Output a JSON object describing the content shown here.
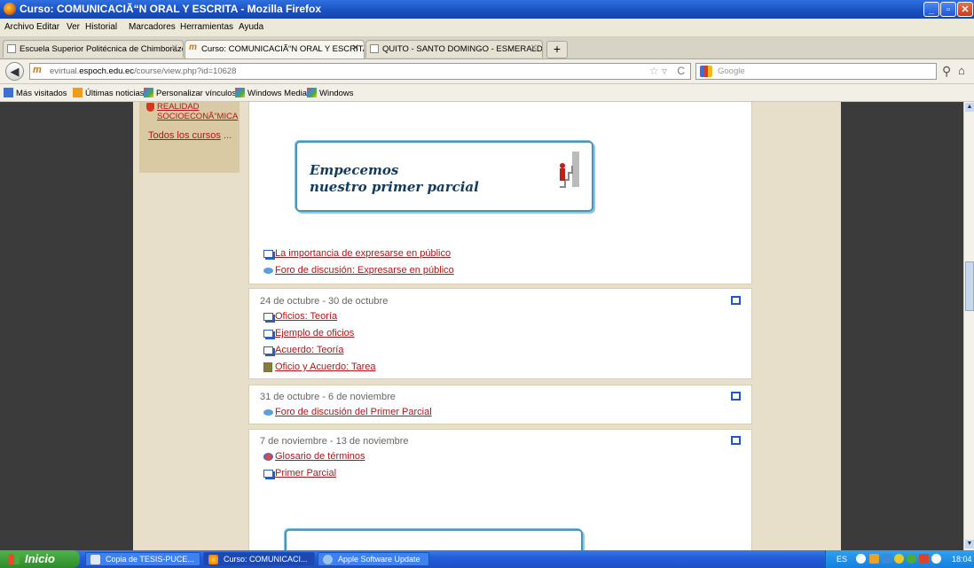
{
  "window": {
    "title": "Curso: COMUNICACIÃ“N ORAL Y ESCRITA - Mozilla Firefox"
  },
  "menu": [
    "Archivo",
    "Editar",
    "Ver",
    "Historial",
    "Marcadores",
    "Herramientas",
    "Ayuda"
  ],
  "tabs": [
    {
      "label": "Escuela Superior Politécnica de Chimborazo",
      "active": false
    },
    {
      "label": "Curso: COMUNICACIÃ“N ORAL Y ESCRITA",
      "active": true
    },
    {
      "label": "QUITO - SANTO DOMINGO - ESMERALDA...",
      "active": false
    }
  ],
  "nav": {
    "url_prefix": "evirtual.",
    "url_domain": "espoch.edu.ec",
    "url_path": "/course/view.php?id=10628",
    "search_placeholder": "Google"
  },
  "bookmarks": [
    "Más visitados",
    "Últimas noticias",
    "Personalizar vínculos",
    "Windows Media",
    "Windows"
  ],
  "sidebar": {
    "link1_line1": "REALIDAD",
    "link1_line2": "SOCIOECONÃ“MICA",
    "all_courses": "Todos los cursos",
    "all_courses_suffix": "..."
  },
  "banner1": {
    "line1": "Empecemos",
    "line2": "nuestro primer parcial"
  },
  "section0": {
    "activities": [
      {
        "type": "resource",
        "label": "La importancia de expresarse en público"
      },
      {
        "type": "forum",
        "label": "Foro de discusión: Expresarse en público"
      }
    ]
  },
  "section1": {
    "date": "24 de octubre - 30 de octubre",
    "activities": [
      {
        "type": "resource",
        "label": "Oficios: Teoría"
      },
      {
        "type": "resource",
        "label": "Ejemplo de oficios"
      },
      {
        "type": "resource",
        "label": "Acuerdo: Teoría"
      },
      {
        "type": "assignment",
        "label": "Oficio y Acuerdo: Tarea"
      }
    ]
  },
  "section2": {
    "date": "31 de octubre - 6 de noviembre",
    "activities": [
      {
        "type": "forum",
        "label": "Foro de discusión del Primer Parcial"
      }
    ]
  },
  "section3": {
    "date": "7 de noviembre - 13 de noviembre",
    "activities": [
      {
        "type": "glossary",
        "label": "Glosario de términos"
      },
      {
        "type": "quiz",
        "label": "Primer Parcial"
      }
    ]
  },
  "taskbar": {
    "start": "Inicio",
    "tasks": [
      {
        "label": "Copia de TESIS-PUCE...",
        "active": false
      },
      {
        "label": "Curso: COMUNICACI...",
        "active": true
      },
      {
        "label": "Apple Software Update",
        "active": false
      }
    ],
    "lang": "ES",
    "clock": "18:04"
  }
}
